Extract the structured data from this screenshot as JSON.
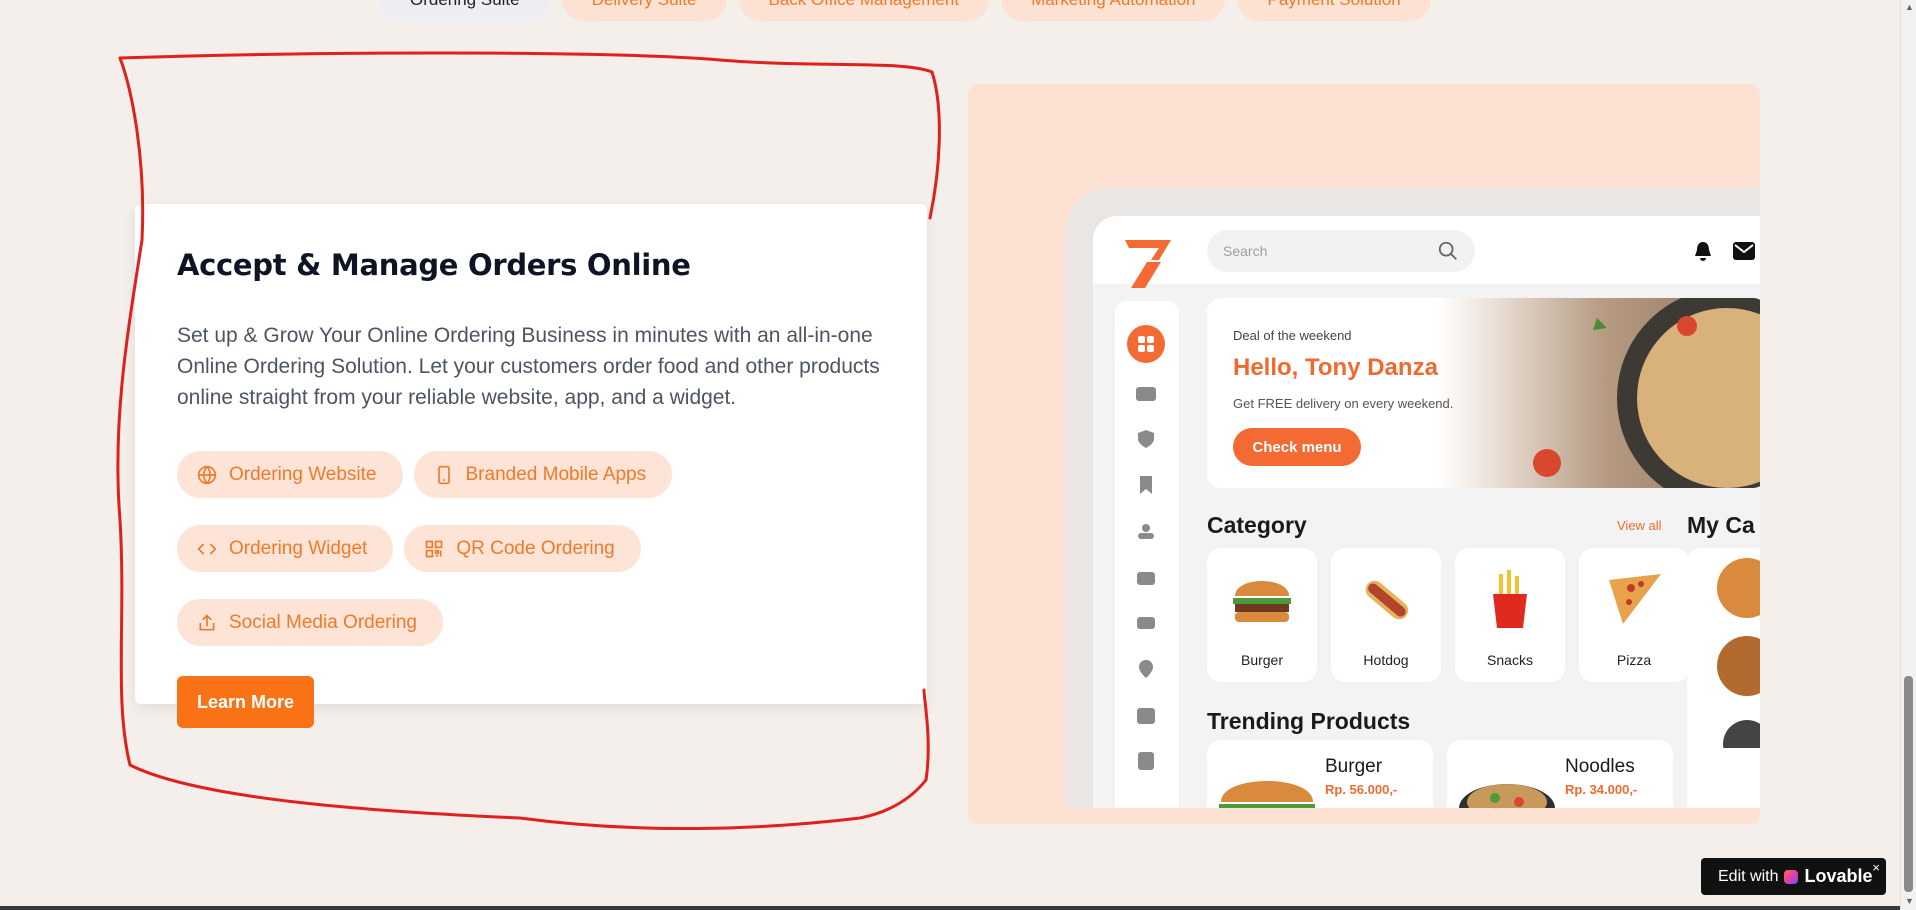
{
  "top_tabs": [
    {
      "label": "Ordering Suite",
      "active": true
    },
    {
      "label": "Delivery Suite",
      "active": false
    },
    {
      "label": "Back Office Management",
      "active": false
    },
    {
      "label": "Marketing Automation",
      "active": false
    },
    {
      "label": "Payment Solution",
      "active": false
    }
  ],
  "feature": {
    "title": "Accept & Manage Orders Online",
    "description": "Set up & Grow Your Online Ordering Business in minutes with an all-in-one Online Ordering Solution. Let your customers order food and other products online straight from your reliable website, app, and a widget.",
    "chips": [
      {
        "label": "Ordering Website",
        "icon": "globe-icon"
      },
      {
        "label": "Branded Mobile Apps",
        "icon": "smartphone-icon"
      },
      {
        "label": "Ordering Widget",
        "icon": "code-icon"
      },
      {
        "label": "QR Code Ordering",
        "icon": "qr-code-icon"
      },
      {
        "label": "Social Media Ordering",
        "icon": "share-icon"
      }
    ],
    "cta_label": "Learn More"
  },
  "preview": {
    "search_placeholder": "Search",
    "hero": {
      "deal": "Deal of the weekend",
      "greeting": "Hello, Tony Danza",
      "subtitle": "Get FREE delivery on every weekend.",
      "button": "Check menu"
    },
    "category_title": "Category",
    "view_all": "View all",
    "my_cart_title": "My Ca",
    "categories": [
      "Burger",
      "Hotdog",
      "Snacks",
      "Pizza"
    ],
    "trending_title": "Trending Products",
    "products": [
      {
        "name": "Burger",
        "price": "Rp. 56.000,-"
      },
      {
        "name": "Noodles",
        "price": "Rp. 34.000,-"
      }
    ]
  },
  "badge": {
    "prefix": "Edit with",
    "brand": "Lovable",
    "close": "×"
  },
  "colors": {
    "accent": "#f97316",
    "chip_bg": "#fde4d6",
    "panel_bg": "#fde1d3",
    "page_bg": "#f4efea"
  }
}
